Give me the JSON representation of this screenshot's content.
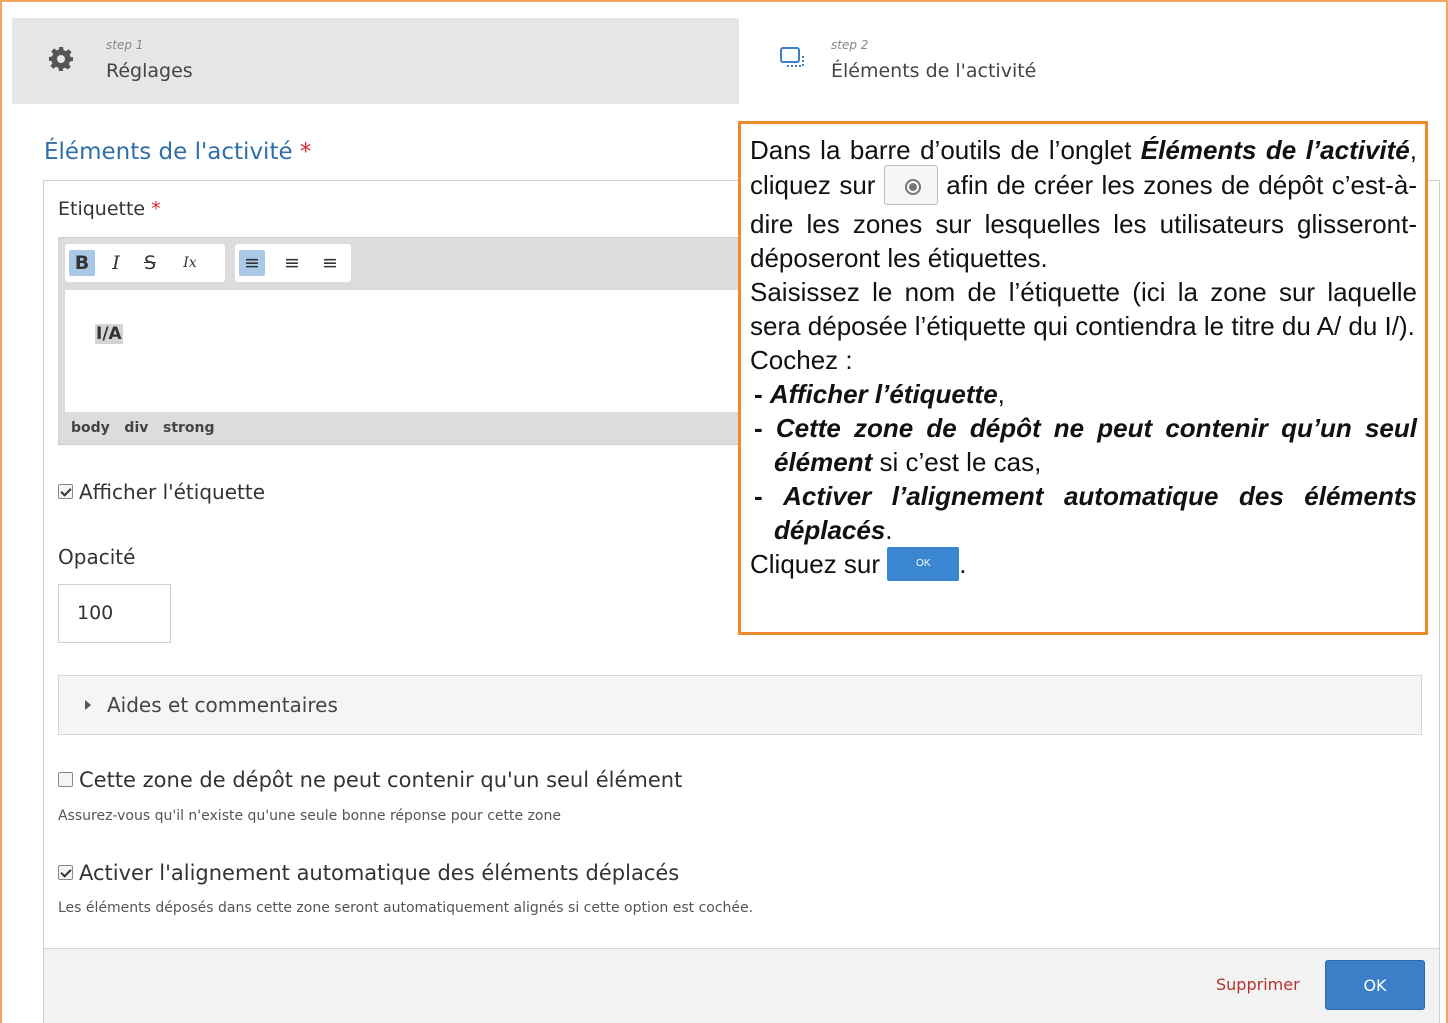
{
  "tabs": [
    {
      "step": "step 1",
      "name": "Réglages",
      "icon": "gear-icon"
    },
    {
      "step": "step 2",
      "name": "Éléments de l'activité",
      "icon": "screen-selection-icon"
    }
  ],
  "section": {
    "title": "Éléments de l'activité",
    "required_mark": "*"
  },
  "etiquette": {
    "label": "Etiquette",
    "required_mark": "*",
    "toolbar": {
      "bold": "B",
      "italic": "I",
      "strike": "S",
      "clear": "Ix",
      "align_left": "≡",
      "align_center": "≡",
      "align_right": "≡"
    },
    "content": "I/A",
    "path": [
      "body",
      "div",
      "strong"
    ]
  },
  "afficher": {
    "label": "Afficher l'étiquette",
    "checked": true
  },
  "opacite": {
    "label": "Opacité",
    "value": "100"
  },
  "aides": {
    "label": "Aides et commentaires"
  },
  "seul": {
    "label": "Cette zone de dépôt ne peut contenir qu'un seul élément",
    "hint": "Assurez-vous qu'il n'existe qu'une seule bonne réponse pour cette zone",
    "checked": false
  },
  "alignement": {
    "label": "Activer l'alignement automatique des éléments déplacés",
    "hint": "Les éléments déposés dans cette zone seront automatiquement alignés si cette option est cochée.",
    "checked": true
  },
  "footer": {
    "delete_label": "Supprimer",
    "ok_label": "OK"
  },
  "callout": {
    "p1_a": "Dans la barre d’outils de l’onglet ",
    "p1_b": "Éléments de l’activité",
    "p1_c": ", cliquez sur ",
    "p1_d": " afin de créer les zones de dépôt c’est-à-dire les zones sur lesquelles les utilisateurs glisseront-déposeront les étiquettes.",
    "p2": "Saisissez le nom de l’étiquette (ici la zone sur laquelle sera déposée l’étiquette qui contiendra le titre du A/ du I/).",
    "p3": "Cochez :",
    "li1_b": "Afficher l’étiquette",
    "li1_c": ",",
    "li2_b": "Cette zone de dépôt ne peut contenir qu’un seul élément",
    "li2_c": " si c’est le cas,",
    "li3_b": "Activer l’alignement automatique des éléments déplacés",
    "li3_c": ".",
    "p4_a": "Cliquez sur ",
    "p4_ok": "OK",
    "p4_c": "."
  }
}
